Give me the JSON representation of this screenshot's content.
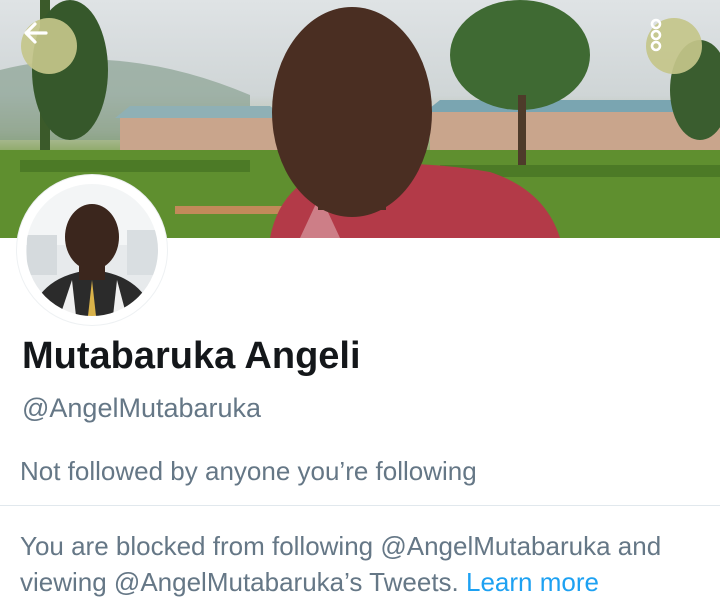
{
  "profile": {
    "name": "Mutabaruka Angeli",
    "handle": "@AngelMutabaruka",
    "follow_note": "Not followed by anyone you’re following",
    "blocked_text": "You are blocked from following @AngelMutabaruka and viewing @AngelMutabaruka’s Tweets. ",
    "learn_more": "Learn more"
  },
  "icons": {
    "back": "arrow-left-icon",
    "more": "more-vertical-icon"
  },
  "colors": {
    "name": "#14171a",
    "secondary_text": "#657786",
    "link": "#1da1f2",
    "header_button": "#c4c68a"
  }
}
